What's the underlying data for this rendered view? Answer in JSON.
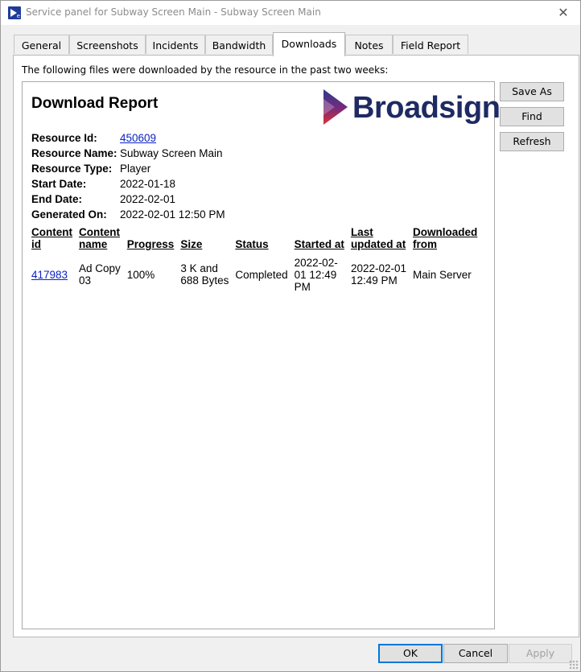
{
  "window": {
    "title": "Service panel for Subway Screen Main - Subway Screen Main"
  },
  "tabs": [
    {
      "label": "General",
      "active": false
    },
    {
      "label": "Screenshots",
      "active": false
    },
    {
      "label": "Incidents",
      "active": false
    },
    {
      "label": "Bandwidth",
      "active": false
    },
    {
      "label": "Downloads",
      "active": true
    },
    {
      "label": "Notes",
      "active": false
    },
    {
      "label": "Field Report",
      "active": false
    }
  ],
  "intro_text": "The following files were downloaded by the resource in the past two weeks:",
  "report": {
    "title": "Download Report",
    "logo_text": "Broadsign",
    "meta": {
      "resource_id_label": "Resource Id:",
      "resource_id": "450609",
      "resource_name_label": "Resource Name:",
      "resource_name": "Subway Screen Main",
      "resource_type_label": "Resource Type:",
      "resource_type": "Player",
      "start_date_label": "Start Date:",
      "start_date": "2022-01-18",
      "end_date_label": "End Date:",
      "end_date": "2022-02-01",
      "generated_on_label": "Generated On:",
      "generated_on": "2022-02-01 12:50 PM"
    },
    "table": {
      "headers": {
        "content_id_1": "Content",
        "content_id_2": "id",
        "content_name_1": "Content",
        "content_name_2": "name",
        "progress": "Progress",
        "size": "Size",
        "status": "Status",
        "started_at": "Started at",
        "last_updated_1": "Last",
        "last_updated_2": "updated at",
        "downloaded_from_1": "Downloaded",
        "downloaded_from_2": "from"
      },
      "rows": [
        {
          "content_id": "417983",
          "content_name_1": "Ad Copy",
          "content_name_2": "03",
          "progress": "100%",
          "size_1": "3 K and",
          "size_2": "688 Bytes",
          "status": "Completed",
          "started_1": "2022-02-",
          "started_2": "01 12:49",
          "started_3": "PM",
          "updated_1": "2022-02-01",
          "updated_2": "12:49 PM",
          "from": "Main Server"
        }
      ]
    }
  },
  "side_buttons": {
    "save_as": "Save As",
    "find": "Find",
    "refresh": "Refresh"
  },
  "footer_buttons": {
    "ok": "OK",
    "cancel": "Cancel",
    "apply": "Apply"
  },
  "colors": {
    "link": "#0b22c4",
    "logo_text": "#1e2a63",
    "accent_focus": "#0078d7"
  }
}
